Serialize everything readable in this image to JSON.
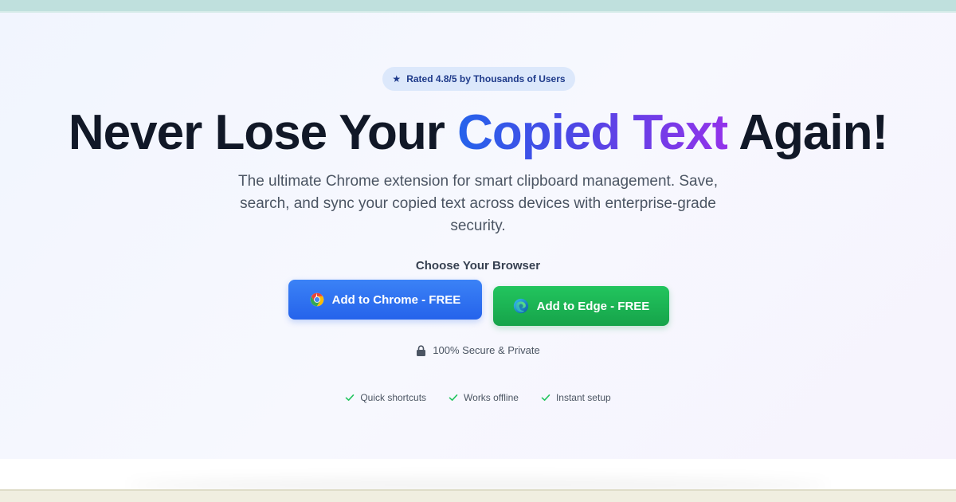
{
  "badge": {
    "icon": "star-icon",
    "text": "Rated 4.8/5 by Thousands of Users"
  },
  "headline": {
    "part1": "Never Lose Your ",
    "highlight": "Copied Text",
    "part2": " Again!"
  },
  "subtitle": "The ultimate Chrome extension for smart clipboard management. Save, search, and sync your copied text across devices with enterprise-grade security.",
  "browser_choice": {
    "heading": "Choose Your Browser",
    "chrome_button": {
      "label": "Add to Chrome - FREE",
      "icon": "chrome-icon"
    },
    "edge_button": {
      "label": "Add to Edge - FREE",
      "icon": "edge-icon"
    }
  },
  "secure_text": "100% Secure & Private",
  "features": [
    {
      "label": "Quick shortcuts",
      "icon": "check-icon"
    },
    {
      "label": "Works offline",
      "icon": "check-icon"
    },
    {
      "label": "Instant setup",
      "icon": "check-icon"
    }
  ],
  "colors": {
    "chrome_blue": "#2563eb",
    "edge_green": "#16a34a",
    "gradient_start": "#2563eb",
    "gradient_end": "#9333ea",
    "badge_bg": "#dce8fb",
    "check_green": "#22c55e"
  }
}
